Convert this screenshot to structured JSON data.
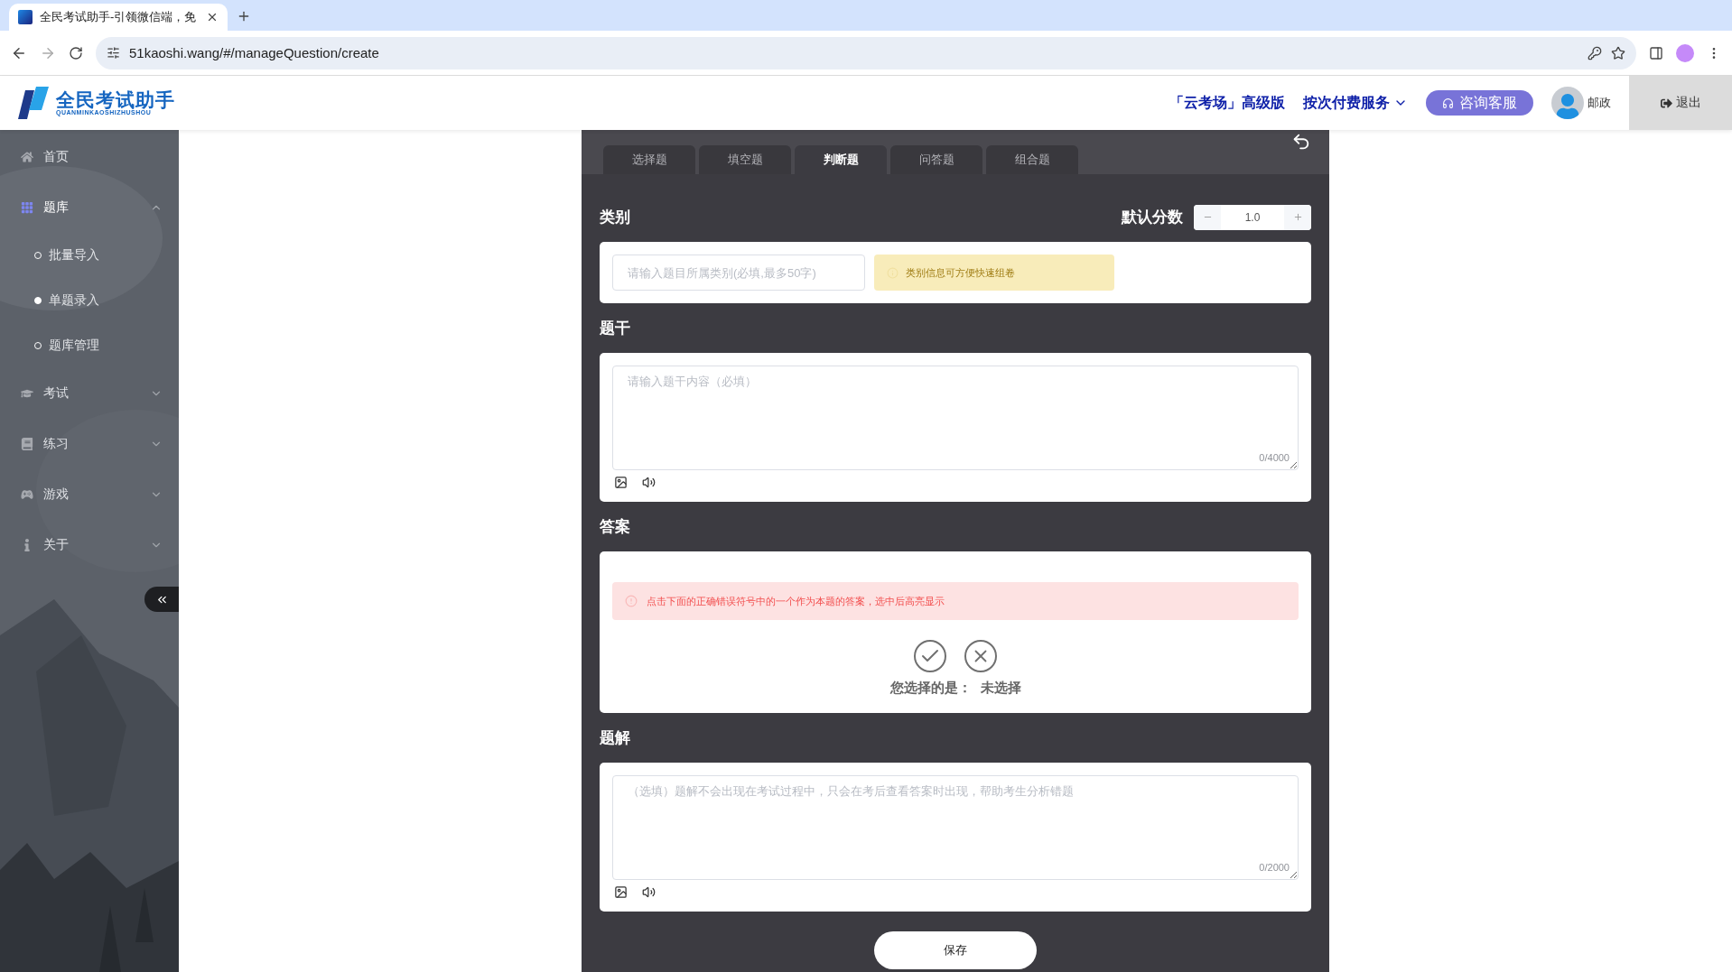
{
  "browser": {
    "tab_title": "全民考试助手-引领微信端，免",
    "url": "51kaoshi.wang/#/manageQuestion/create"
  },
  "header": {
    "logo_text": "全民考试助手",
    "logo_subtext": "QUANMINKAOSHIZHUSHOU",
    "premium": "「云考场」高级版",
    "pay_service": "按次付费服务",
    "consult_button": "咨询客服",
    "user_name": "邮政",
    "logout": "退出"
  },
  "sidebar": {
    "items": [
      {
        "label": "首页",
        "kind": "link",
        "selected": false
      },
      {
        "label": "题库",
        "kind": "group",
        "selected": true,
        "expanded": true,
        "children": [
          {
            "label": "批量导入",
            "selected": false
          },
          {
            "label": "单题录入",
            "selected": true
          },
          {
            "label": "题库管理",
            "selected": false
          }
        ]
      },
      {
        "label": "考试",
        "kind": "group",
        "selected": false,
        "expanded": false
      },
      {
        "label": "练习",
        "kind": "group",
        "selected": false,
        "expanded": false
      },
      {
        "label": "游戏",
        "kind": "group",
        "selected": false,
        "expanded": false
      },
      {
        "label": "关于",
        "kind": "group",
        "selected": false,
        "expanded": false
      }
    ]
  },
  "tabs": [
    {
      "label": "选择题",
      "selected": false
    },
    {
      "label": "填空题",
      "selected": false
    },
    {
      "label": "判断题",
      "selected": true
    },
    {
      "label": "问答题",
      "selected": false
    },
    {
      "label": "组合题",
      "selected": false
    }
  ],
  "category": {
    "title": "类别",
    "score_label": "默认分数",
    "score": "1.0",
    "placeholder": "请输入题目所属类别(必填,最多50字)",
    "tip": "类别信息可方便快速组卷"
  },
  "stem": {
    "title": "题干",
    "placeholder": "请输入题干内容（必填）",
    "counter": "0/4000"
  },
  "answer": {
    "title": "答案",
    "tip": "点击下面的正确错误符号中的一个作为本题的答案，选中后高亮显示",
    "options": [
      {
        "kind": "true",
        "selected": false
      },
      {
        "kind": "false",
        "selected": false
      }
    ],
    "chosen_label": "您选择的是：",
    "chosen_value": "未选择"
  },
  "explanation": {
    "title": "题解",
    "placeholder": "（选填）题解不会出现在考试过程中，只会在考后查看答案时出现，帮助考生分析错题",
    "counter": "0/2000"
  },
  "save_button": "保存"
}
